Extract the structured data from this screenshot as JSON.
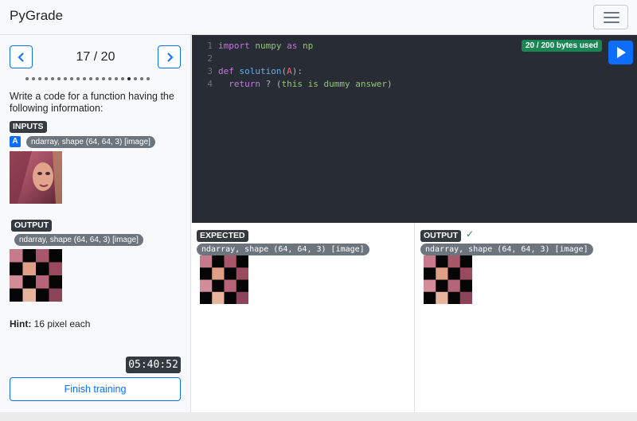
{
  "app": {
    "title": "PyGrade"
  },
  "sidebar": {
    "counter": "17 / 20",
    "progress": {
      "total": 20,
      "current": 17
    },
    "description": "Write a code for a function having the following information:",
    "inputs_label": "INPUTS",
    "input_var": "A",
    "input_type": "ndarray, shape (64, 64, 3) [image]",
    "output_label": "OUTPUT",
    "output_type": "ndarray, shape (64, 64, 3) [image]",
    "hint_label": "Hint:",
    "hint_text": " 16 pixel each",
    "timer": "05:40:52",
    "finish_label": "Finish training"
  },
  "editor": {
    "bytes_used": "20 / 200 bytes used",
    "lines": [
      {
        "n": "1",
        "tokens": [
          {
            "t": "import",
            "c": "kw"
          },
          {
            "t": " "
          },
          {
            "t": "numpy",
            "c": "txt"
          },
          {
            "t": " "
          },
          {
            "t": "as",
            "c": "kw"
          },
          {
            "t": " "
          },
          {
            "t": "np",
            "c": "txt"
          }
        ]
      },
      {
        "n": "2",
        "tokens": []
      },
      {
        "n": "3",
        "tokens": [
          {
            "t": "def",
            "c": "kw"
          },
          {
            "t": " "
          },
          {
            "t": "solution",
            "c": "fn"
          },
          {
            "t": "("
          },
          {
            "t": "A",
            "c": "var"
          },
          {
            "t": "):"
          }
        ]
      },
      {
        "n": "4",
        "tokens": [
          {
            "t": "  "
          },
          {
            "t": "return",
            "c": "kw"
          },
          {
            "t": " ? ("
          },
          {
            "t": "this is dummy answer",
            "c": "txt"
          },
          {
            "t": ")"
          }
        ]
      }
    ]
  },
  "results": {
    "expected_label": "EXPECTED",
    "expected_type": "ndarray, shape (64, 64, 3) [image]",
    "output_label": "OUTPUT",
    "output_type": "ndarray, shape (64, 64, 3) [image]",
    "output_status": "✓"
  },
  "colors": {
    "primary": "#0d6efd",
    "success": "#198754",
    "editor_bg": "#282c34",
    "badge_dark": "#343a40",
    "pill_gray": "#6c757d"
  },
  "icons": {
    "prev": "chevron-left-icon",
    "next": "chevron-right-icon",
    "menu": "hamburger-menu-icon",
    "run": "play-icon",
    "status": "check-icon"
  }
}
